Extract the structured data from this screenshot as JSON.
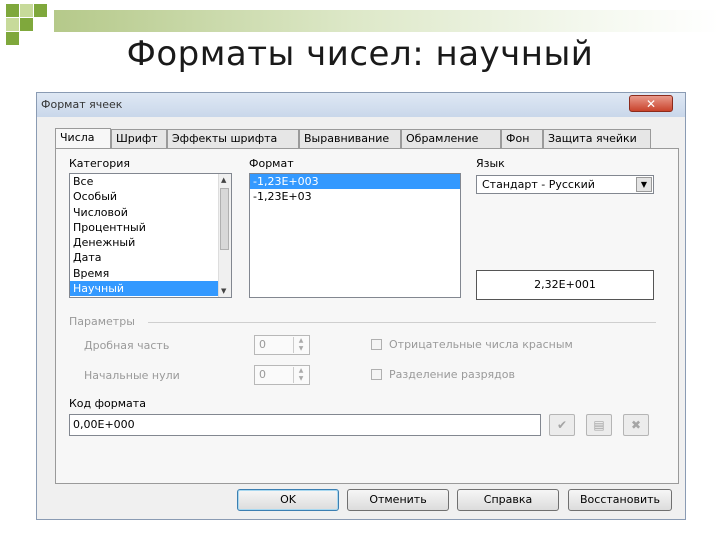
{
  "slide": {
    "title": "Форматы чисел: научный",
    "colors": {
      "band": "#b5c98a",
      "square_dark": "#7fa83c",
      "square_light": "#c7da9a"
    }
  },
  "dialog": {
    "title": "Формат ячеек",
    "close_icon": "close-icon",
    "tabs": [
      "Числа",
      "Шрифт",
      "Эффекты шрифта",
      "Выравнивание",
      "Обрамление",
      "Фон",
      "Защита ячейки"
    ],
    "active_tab": "Числа",
    "category": {
      "label": "Категория",
      "items": [
        "Все",
        "Особый",
        "Числовой",
        "Процентный",
        "Денежный",
        "Дата",
        "Время",
        "Научный"
      ],
      "selected": "Научный"
    },
    "format": {
      "label": "Формат",
      "items": [
        "-1,23E+003",
        "-1,23E+03"
      ],
      "selected": "-1,23E+003"
    },
    "language": {
      "label": "Язык",
      "value": "Стандарт - Русский"
    },
    "preview": "2,32E+001",
    "params": {
      "label": "Параметры",
      "decimals_label": "Дробная часть",
      "decimals_value": "0",
      "leading_zeros_label": "Начальные нули",
      "leading_zeros_value": "0",
      "negative_red_label": "Отрицательные числа красным",
      "thousands_sep_label": "Разделение разрядов"
    },
    "format_code": {
      "label": "Код формата",
      "value": "0,00E+000"
    },
    "buttons": {
      "ok": "OK",
      "cancel": "Отменить",
      "help": "Справка",
      "reset": "Восстановить"
    }
  }
}
